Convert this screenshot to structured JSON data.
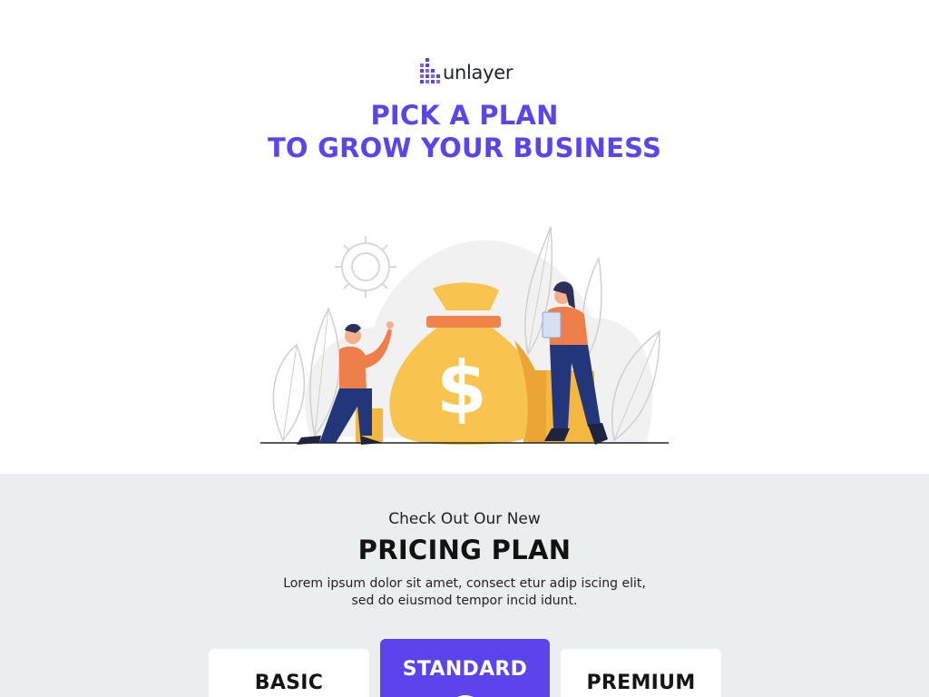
{
  "brand": {
    "name": "unlayer",
    "accent_color": "#5a44ec",
    "logo_icon": "pixel-grid-logo-icon"
  },
  "hero": {
    "headline_line1": "PICK A PLAN",
    "headline_line2": "TO GROW YOUR BUSINESS",
    "illustration": "money-bag-business-illustration"
  },
  "pricing": {
    "subtitle": "Check Out Our New",
    "title": "PRICING PLAN",
    "description_line1": "Lorem ipsum dolor sit amet, consect etur adip iscing elit,",
    "description_line2": "sed do eiusmod tempor incid idunt.",
    "background_color": "#eaeeee",
    "plans": [
      {
        "name": "BASIC",
        "highlighted": false
      },
      {
        "name": "STANDARD",
        "highlighted": true
      },
      {
        "name": "PREMIUM",
        "highlighted": false
      }
    ]
  }
}
